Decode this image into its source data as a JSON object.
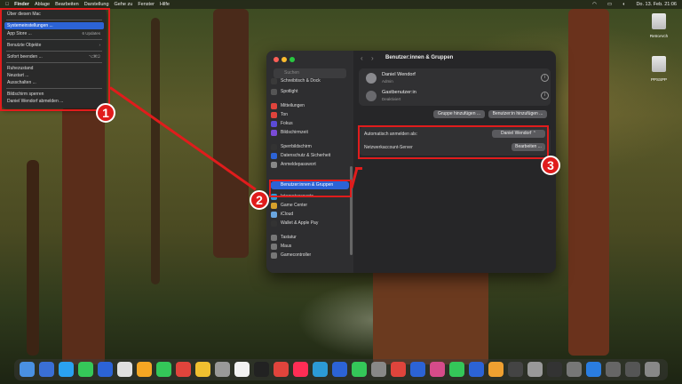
{
  "menubar": {
    "items": [
      "Finder",
      "Ablage",
      "Bearbeiten",
      "Darstellung",
      "Gehe zu",
      "Fenster",
      "Hilfe"
    ],
    "clock": "Do. 13. Feb.  21:06"
  },
  "apple_menu": {
    "about": "Über diesen Mac",
    "settings": "Systemeinstellungen ...",
    "appstore": "App Store ...",
    "appstore_badge": "6 Updates",
    "recent": "Benutzte Objekte",
    "force_quit": "Sofort beenden ...",
    "force_quit_shortcut": "⌥⌘⎋",
    "sleep": "Ruhezustand",
    "restart": "Neustart ...",
    "shutdown": "Ausschalten ...",
    "lock": "Bildschirm sperren",
    "logout": "Daniel Wendorf abmelden ..."
  },
  "annotations": {
    "one": "1",
    "two": "2",
    "three": "3"
  },
  "window": {
    "search_placeholder": "Suchen",
    "sidebar_items": [
      {
        "label": "Schreibtisch & Dock",
        "color": "#3a3a3a"
      },
      {
        "label": "Spotlight",
        "color": "#555"
      },
      {
        "label": "Mitteilungen",
        "color": "#e0443c"
      },
      {
        "label": "Ton",
        "color": "#e0443c"
      },
      {
        "label": "Fokus",
        "color": "#5b4bd6"
      },
      {
        "label": "Bildschirmzeit",
        "color": "#7a4bd6"
      },
      {
        "label": "Sperrbildschirm",
        "color": "#333"
      },
      {
        "label": "Datenschutz & Sicherheit",
        "color": "#2c63d6"
      },
      {
        "label": "Anmeldepasswort",
        "color": "#888"
      },
      {
        "label": "Benutzer:innen & Gruppen",
        "color": "#2c63d6"
      },
      {
        "label": "Internetaccounts",
        "color": "#2c9ad6"
      },
      {
        "label": "Game Center",
        "color": "#d6a12c"
      },
      {
        "label": "iCloud",
        "color": "#6aa6e0"
      },
      {
        "label": "Wallet & Apple Pay",
        "color": "#333"
      },
      {
        "label": "Tastatur",
        "color": "#777"
      },
      {
        "label": "Maus",
        "color": "#777"
      },
      {
        "label": "Gamecontroller",
        "color": "#777"
      }
    ],
    "title": "Benutzer:innen & Gruppen",
    "users": [
      {
        "name": "Daniel Wendorf",
        "role": "Admin"
      },
      {
        "name": "Gastbenutzer:in",
        "role": "Deaktiviert"
      }
    ],
    "add_group_button": "Gruppe hinzufügen ...",
    "add_user_button": "Benutzer:in hinzufügen ...",
    "auto_login_label": "Automatisch anmelden als:",
    "auto_login_value": "Daniel Wendorf ⌃",
    "network_server_label": "Netzwerkaccount-Server",
    "network_server_button": "Bearbeiten ..."
  },
  "desktop": {
    "icons": [
      "RetroArch",
      "PPSSPP"
    ]
  }
}
